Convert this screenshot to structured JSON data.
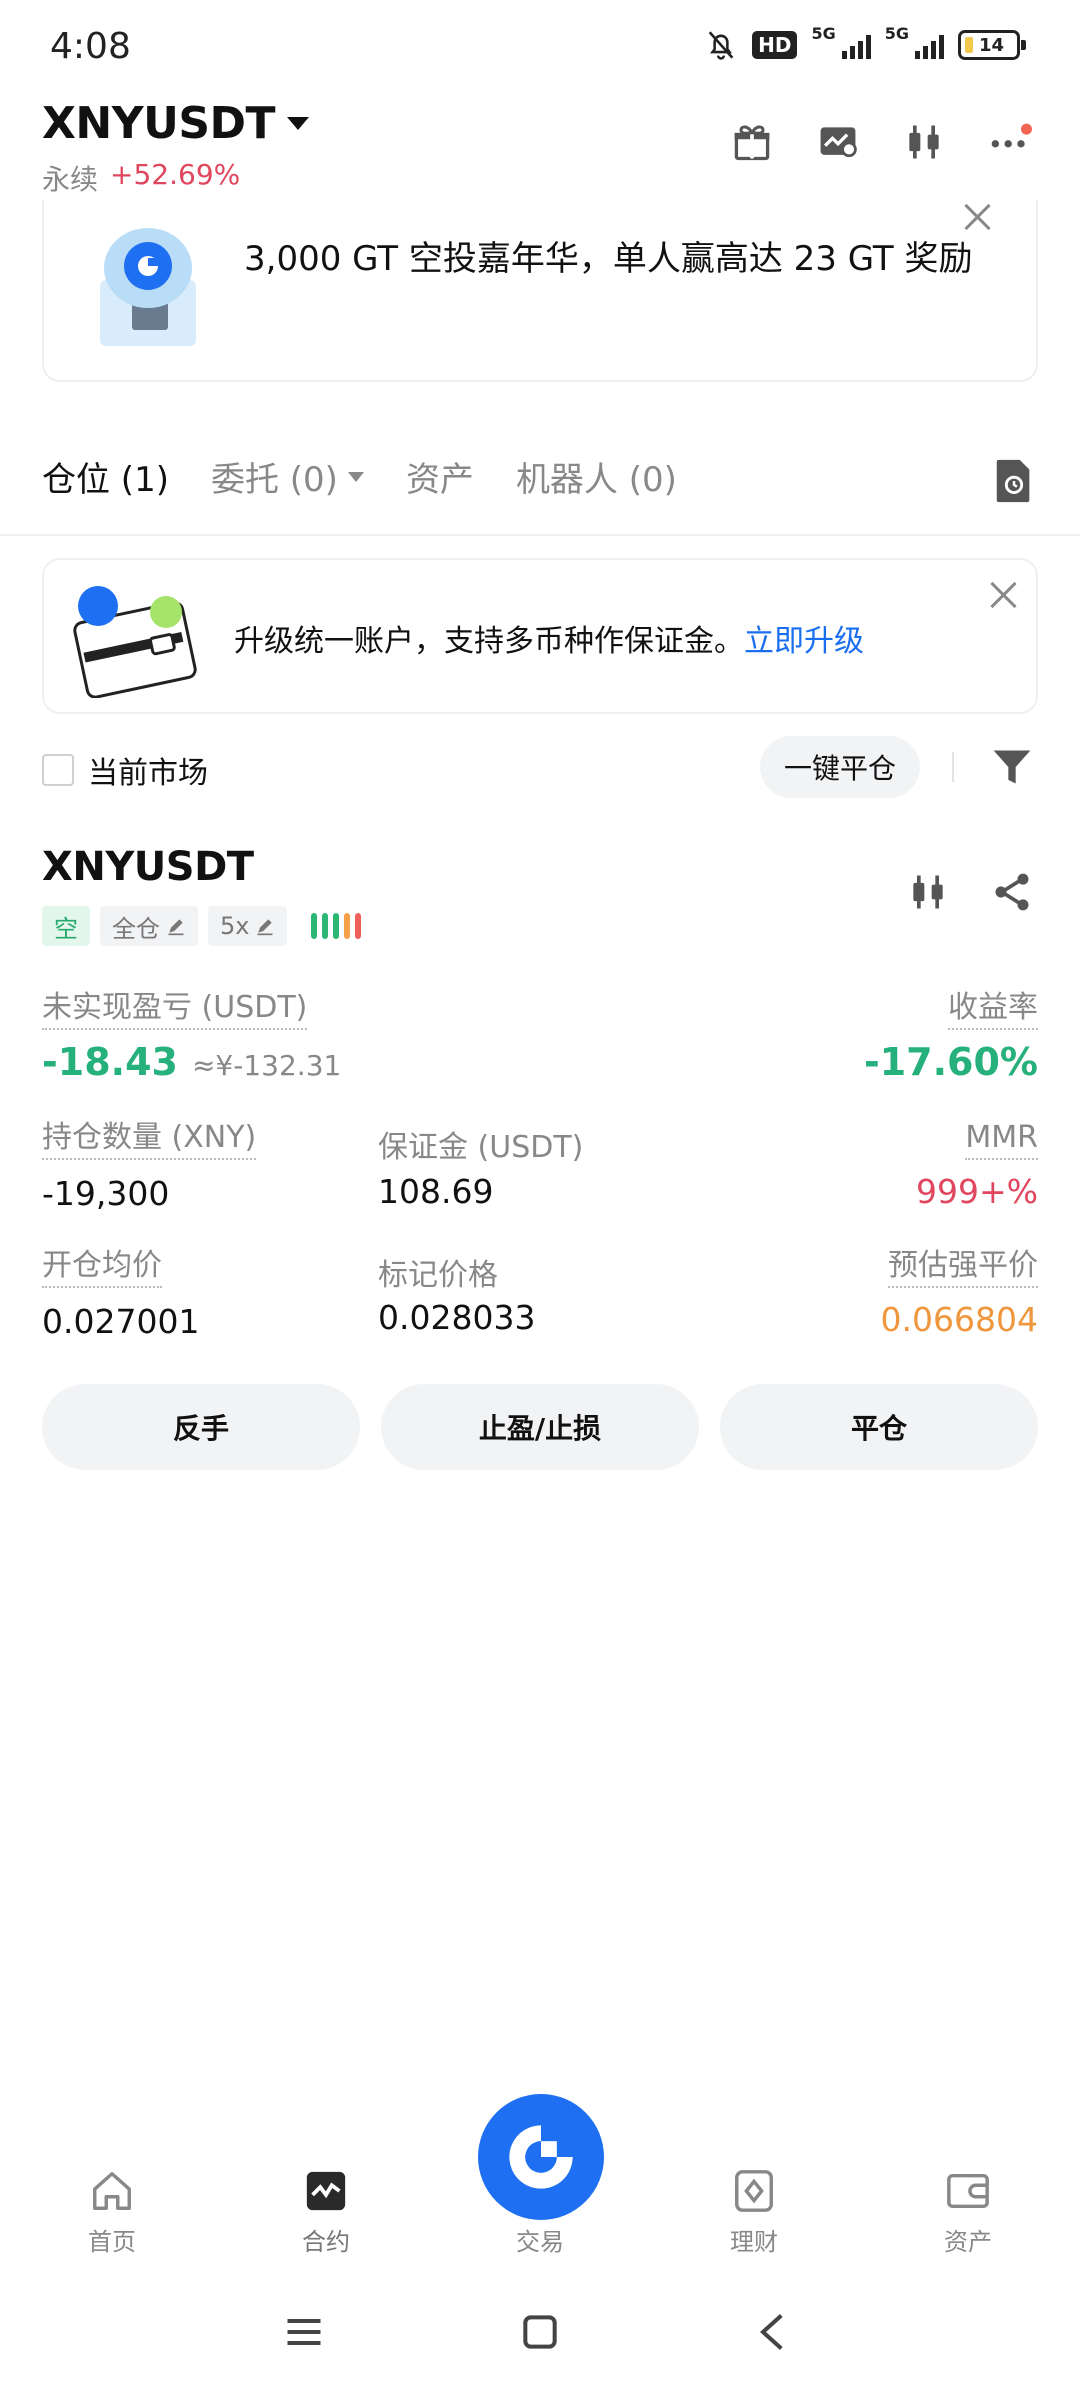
{
  "status_bar": {
    "time": "4:08",
    "network_1": "5G",
    "network_2": "5G",
    "hd": "HD",
    "battery": "14"
  },
  "header": {
    "pair": "XNYUSDT",
    "market_type": "永续",
    "change": "+52.69%"
  },
  "promo_banner": {
    "text": "3,000 GT 空投嘉年华，单人赢高达 23 GT 奖励"
  },
  "tabs": [
    {
      "label": "仓位 (1)"
    },
    {
      "label": "委托 (0)"
    },
    {
      "label": "资产"
    },
    {
      "label": "机器人 (0)"
    }
  ],
  "upgrade_banner": {
    "text": "升级统一账户，支持多币种作保证金。",
    "link": "立即升级"
  },
  "filters": {
    "current_market": "当前市场",
    "close_all": "一键平仓"
  },
  "position": {
    "symbol": "XNYUSDT",
    "side_tag": "空",
    "margin_mode": "全仓",
    "leverage": "5x",
    "unrealized_pnl_label": "未实现盈亏 (USDT)",
    "unrealized_pnl": "-18.43",
    "unrealized_pnl_cny": "≈¥-132.31",
    "roe_label": "收益率",
    "roe": "-17.60%",
    "qty_label": "持仓数量 (XNY)",
    "qty": "-19,300",
    "margin_label": "保证金 (USDT)",
    "margin": "108.69",
    "mmr_label": "MMR",
    "mmr": "999+%",
    "entry_label": "开仓均价",
    "entry": "0.027001",
    "mark_label": "标记价格",
    "mark": "0.028033",
    "liq_label": "预估强平价",
    "liq": "0.066804"
  },
  "actions": {
    "reverse": "反手",
    "tpsl": "止盈/止损",
    "close": "平仓"
  },
  "bottom_nav": [
    {
      "label": "首页",
      "icon": "home-icon"
    },
    {
      "label": "合约",
      "icon": "futures-icon"
    },
    {
      "label": "交易",
      "icon": "trade-logo-icon"
    },
    {
      "label": "理财",
      "icon": "earn-icon"
    },
    {
      "label": "资产",
      "icon": "wallet-icon"
    }
  ],
  "colors": {
    "green": "#26b07b",
    "red": "#e0465e",
    "orange": "#f0963c",
    "link_blue": "#1a6ff0",
    "brand_blue": "#1e6ff2"
  }
}
